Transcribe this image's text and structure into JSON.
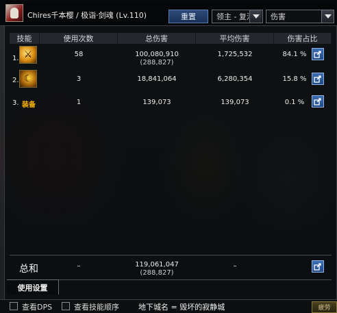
{
  "window": {
    "character_title": "Chires千本樱 / 极诣·剑魂 (Lv.110)",
    "reset_label": "重置",
    "filter_value": "领主 - 复活...",
    "metric_value": "伤害"
  },
  "columns": [
    "技能",
    "使用次数",
    "总伤害",
    "平均伤害",
    "伤害占比"
  ],
  "rows": [
    {
      "index": "1.",
      "icon": "sword-burst-skill-icon",
      "icon_glyph": "⚔",
      "uses": "58",
      "total": "100,080,910",
      "total_sub": "(288,827)",
      "avg": "1,725,532",
      "pct": "84.1 %"
    },
    {
      "index": "2.",
      "icon": "crescent-slash-skill-icon",
      "icon_glyph": "☾",
      "uses": "3",
      "total": "18,841,064",
      "total_sub": "",
      "avg": "6,280,354",
      "pct": "15.8 %"
    },
    {
      "index": "3.",
      "label": "装备",
      "uses": "1",
      "total": "139,073",
      "total_sub": "",
      "avg": "139,073",
      "pct": "0.1 %"
    }
  ],
  "summary": {
    "label": "总和",
    "uses": "–",
    "total": "119,061,047",
    "total_sub": "(288,827)",
    "avg": "–"
  },
  "tabs": {
    "settings": "使用设置"
  },
  "bottom": {
    "show_dps": "查看DPS",
    "show_skill_order": "查看技能顺序",
    "dungeon": "地下城名 = 毁坏的寂静城",
    "corner_button": "疲劳"
  },
  "colors": {
    "accent_blue": "#2c4a78",
    "equipment_gold": "#ffb400"
  }
}
